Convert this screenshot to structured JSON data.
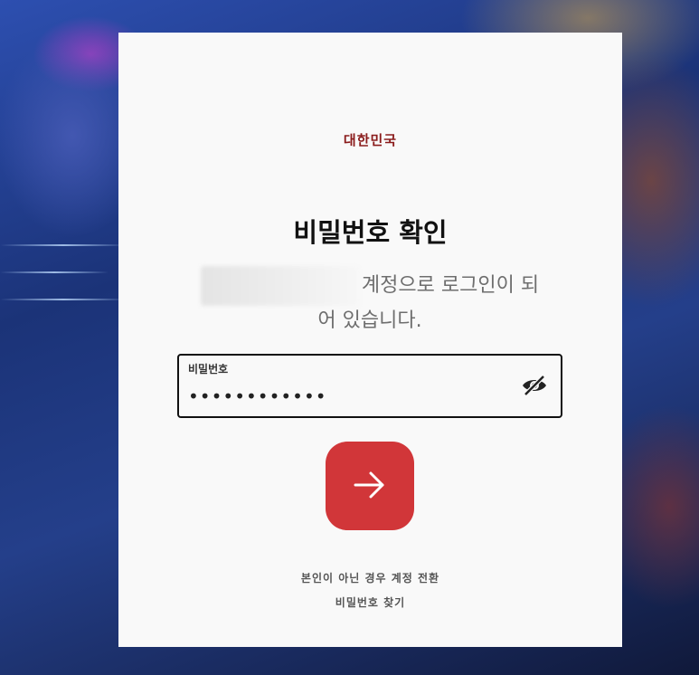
{
  "brand": {
    "label": "대한민국"
  },
  "header": {
    "title": "비밀번호 확인"
  },
  "account": {
    "suffix_line1": "계정으로 로그인이 되",
    "suffix_line2": "어 있습니다."
  },
  "password_field": {
    "label": "비밀번호",
    "value": "••••••••••••",
    "toggle_icon": "eye-slash-icon"
  },
  "submit": {
    "icon": "arrow-right-icon",
    "color": "#d13639"
  },
  "links": {
    "switch_account": "본인이 아닌 경우 계정 전환",
    "forgot_password": "비밀번호 찾기"
  },
  "colors": {
    "brand": "#8a1b1b",
    "card_background": "#f9f9f9",
    "accent": "#d13639"
  }
}
